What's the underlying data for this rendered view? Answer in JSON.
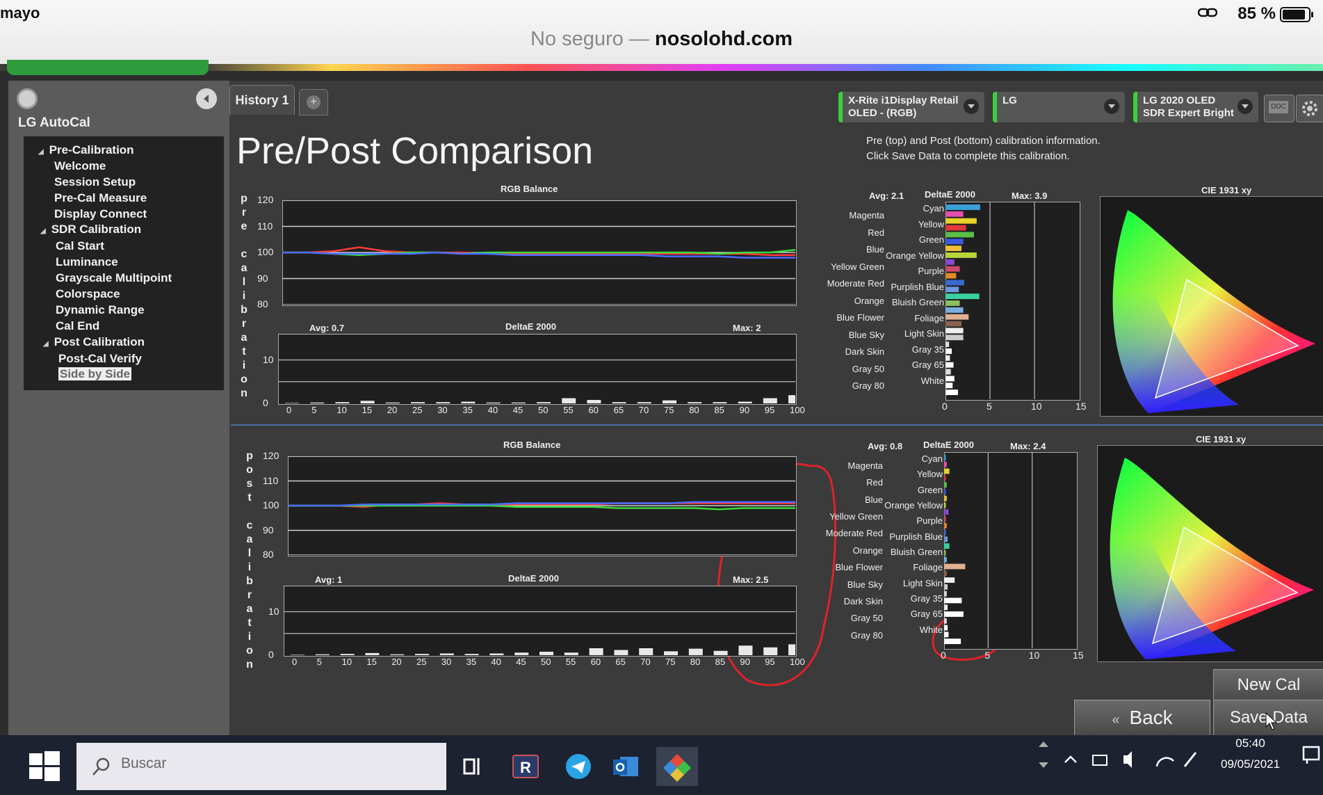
{
  "ios": {
    "time": "mayo",
    "battery": "85 %"
  },
  "browser": {
    "security": "No seguro —",
    "host": "nosolohd.com"
  },
  "sidebar": {
    "title": "LG AutoCal",
    "items": [
      {
        "label": "Pre-Calibration",
        "group": true
      },
      {
        "label": "Welcome"
      },
      {
        "label": "Session Setup"
      },
      {
        "label": "Pre-Cal Measure"
      },
      {
        "label": "Display  Connect"
      },
      {
        "label": "SDR Calibration",
        "group": true
      },
      {
        "label": "Cal Start"
      },
      {
        "label": "Luminance"
      },
      {
        "label": "Grayscale Multipoint"
      },
      {
        "label": "Colorspace"
      },
      {
        "label": "Dynamic Range"
      },
      {
        "label": "Cal End"
      },
      {
        "label": "Post Calibration",
        "group": true
      },
      {
        "label": "Post-Cal Verify"
      },
      {
        "label": "Side by Side",
        "selected": true
      }
    ]
  },
  "tabs": {
    "history": "History 1",
    "add": "+"
  },
  "toolbar": {
    "meter_line1": "X-Rite i1Display Retail",
    "meter_line2": "OLED - (RGB)",
    "display": "LG",
    "mode_line1": "LG 2020 OLED",
    "mode_line2": "SDR Expert Bright",
    "ddc": "DDC"
  },
  "page": {
    "title": "Pre/Post Comparison",
    "info_line1": "Pre (top) and Post (bottom) calibration information.",
    "info_line2": "Click Save Data to complete this calibration."
  },
  "labels": {
    "pre_side": [
      "p",
      "r",
      "e",
      "",
      "c",
      "a",
      "l",
      "i",
      "b",
      "r",
      "a",
      "t",
      "i",
      "o",
      "n"
    ],
    "post_side": [
      "p",
      "o",
      "s",
      "t",
      "",
      "c",
      "a",
      "l",
      "i",
      "b",
      "r",
      "a",
      "t",
      "i",
      "o",
      "n"
    ]
  },
  "chart_data": [
    {
      "id": "pre-rgb",
      "type": "line",
      "title": "RGB Balance",
      "yticks": [
        "120",
        "110",
        "100",
        "90",
        "80"
      ],
      "ylim": [
        80,
        120
      ],
      "x": [
        0,
        5,
        10,
        15,
        20,
        25,
        30,
        35,
        40,
        45,
        50,
        55,
        60,
        65,
        70,
        75,
        80,
        85,
        90,
        95,
        100
      ],
      "series": [
        {
          "color": "#ff3b3b",
          "values": [
            100,
            100,
            100.5,
            102,
            100.5,
            100,
            100,
            100,
            99.5,
            99.5,
            99.5,
            99.5,
            99.5,
            99.5,
            99.5,
            99.5,
            99.5,
            99.5,
            99.5,
            99,
            99
          ]
        },
        {
          "color": "#3bdc3b",
          "values": [
            100,
            100,
            99.5,
            99,
            99.5,
            100,
            100,
            99.5,
            100,
            100,
            100,
            100,
            100,
            100,
            100,
            100,
            100,
            99.5,
            100,
            100,
            101
          ]
        },
        {
          "color": "#4a6bff",
          "values": [
            100,
            100,
            99.5,
            99.5,
            99.5,
            99.5,
            100,
            99.5,
            99.5,
            99,
            99,
            99,
            99,
            99,
            99,
            98.5,
            98.5,
            98.5,
            98,
            98,
            98
          ]
        }
      ]
    },
    {
      "id": "pre-de",
      "type": "bar",
      "title": "DeltaE 2000",
      "avg": "Avg: 0.7",
      "max": "Max: 2",
      "yticks": [
        "10",
        "0"
      ],
      "ylim": [
        0,
        16
      ],
      "categories": [
        "0",
        "5",
        "10",
        "15",
        "20",
        "25",
        "30",
        "35",
        "40",
        "45",
        "50",
        "55",
        "60",
        "65",
        "70",
        "75",
        "80",
        "85",
        "90",
        "95",
        "100"
      ],
      "values": [
        0.1,
        0.2,
        0.3,
        0.6,
        0.2,
        0.3,
        0.3,
        0.4,
        0.2,
        0.2,
        0.3,
        1.2,
        0.8,
        0.3,
        0.3,
        0.7,
        0.3,
        0.3,
        0.4,
        1.2,
        1.9
      ]
    },
    {
      "id": "pre-colors",
      "type": "bar",
      "title": "DeltaE 2000",
      "avg": "Avg: 2.1",
      "max": "Max: 3.9",
      "xticks": [
        "0",
        "5",
        "10",
        "15"
      ],
      "xlim": [
        0,
        15
      ],
      "left_labels": [
        "Magenta",
        "Red",
        "Blue",
        "Yellow Green",
        "Moderate Red",
        "Orange",
        "Blue Flower",
        "Blue Sky",
        "Dark Skin",
        "Gray 50",
        "Gray 80"
      ],
      "categories": [
        "Cyan",
        "Yellow",
        "Green",
        "Orange Yellow",
        "Purple",
        "Purplish Blue",
        "Bluish Green",
        "Foliage",
        "Light Skin",
        "Gray 35",
        "Gray 65",
        "White"
      ],
      "values": [
        3.9,
        2.0,
        3.5,
        2.3,
        3.2,
        2.0,
        1.8,
        3.5,
        1.0,
        1.6,
        1.2,
        2.1,
        1.5,
        3.8,
        1.6,
        2.0,
        2.6,
        1.8,
        2.0,
        2.0,
        0.4,
        0.7,
        0.5,
        0.9,
        0.6,
        1.0,
        0.8,
        1.4
      ],
      "bar_colors": [
        "#3aa0d8",
        "#e64fb0",
        "#e8d12a",
        "#e03a3a",
        "#5bbf4a",
        "#3a5be0",
        "#ecc03a",
        "#b8d63a",
        "#8a4ad0",
        "#d04a6a",
        "#e08a2a",
        "#3a6ad0",
        "#6a9ae0",
        "#3ad0a0",
        "#8ac060",
        "#7ab0e0",
        "#e0b090",
        "#8a6050",
        "#eeeeee",
        "#cccccc",
        "#dddddd",
        "#ffffff",
        "#eeeeee",
        "#ffffff",
        "#dddddd",
        "#ffffff",
        "#ffffff",
        "#ffffff"
      ]
    },
    {
      "id": "post-rgb",
      "type": "line",
      "title": "RGB Balance",
      "yticks": [
        "120",
        "110",
        "100",
        "90",
        "80"
      ],
      "ylim": [
        80,
        120
      ],
      "x": [
        0,
        5,
        10,
        15,
        20,
        25,
        30,
        35,
        40,
        45,
        50,
        55,
        60,
        65,
        70,
        75,
        80,
        85,
        90,
        95,
        100
      ],
      "series": [
        {
          "color": "#ff3b3b",
          "values": [
            100,
            100,
            100,
            99.5,
            100.5,
            100.5,
            101,
            100.5,
            100.5,
            100.5,
            100.5,
            100.5,
            100.5,
            101,
            101,
            101,
            101,
            101,
            101,
            101,
            101
          ]
        },
        {
          "color": "#3bdc3b",
          "values": [
            100,
            100,
            100,
            100,
            100,
            100,
            100,
            100,
            100,
            99.5,
            99.5,
            99.5,
            99.5,
            99,
            99,
            99,
            99,
            98.5,
            99,
            99,
            99
          ]
        },
        {
          "color": "#4a6bff",
          "values": [
            100,
            100,
            100,
            100.5,
            100.5,
            100.5,
            100.5,
            100.5,
            100.5,
            101,
            101,
            101,
            101,
            101,
            101,
            101,
            101.5,
            101.5,
            101.5,
            101.5,
            101.5
          ]
        }
      ]
    },
    {
      "id": "post-de",
      "type": "bar",
      "title": "DeltaE 2000",
      "avg": "Avg: 1",
      "max": "Max: 2.5",
      "yticks": [
        "10",
        "0"
      ],
      "ylim": [
        0,
        16
      ],
      "categories": [
        "0",
        "5",
        "10",
        "15",
        "20",
        "25",
        "30",
        "35",
        "40",
        "45",
        "50",
        "55",
        "60",
        "65",
        "70",
        "75",
        "80",
        "85",
        "90",
        "95",
        "100"
      ],
      "values": [
        0.1,
        0.2,
        0.3,
        0.5,
        0.2,
        0.3,
        0.4,
        0.3,
        0.4,
        0.6,
        0.8,
        0.6,
        1.6,
        1.2,
        1.6,
        0.9,
        1.5,
        1.0,
        2.2,
        1.8,
        2.5
      ]
    },
    {
      "id": "post-colors",
      "type": "bar",
      "title": "DeltaE 2000",
      "avg": "Avg: 0.8",
      "max": "Max: 2.4",
      "xticks": [
        "0",
        "5",
        "10",
        "15"
      ],
      "xlim": [
        0,
        15
      ],
      "left_labels": [
        "Magenta",
        "Red",
        "Blue",
        "Yellow Green",
        "Moderate Red",
        "Orange",
        "Blue Flower",
        "Blue Sky",
        "Dark Skin",
        "Gray 50",
        "Gray 80"
      ],
      "categories": [
        "Cyan",
        "Yellow",
        "Green",
        "Orange Yellow",
        "Purple",
        "Purplish Blue",
        "Bluish Green",
        "Foliage",
        "Light Skin",
        "Gray 35",
        "Gray 65",
        "White"
      ],
      "values": [
        0.2,
        0.3,
        0.6,
        0.2,
        0.3,
        0.2,
        0.3,
        0.2,
        0.5,
        0.2,
        0.3,
        0.2,
        0.4,
        0.6,
        0.2,
        0.3,
        2.4,
        0.3,
        1.2,
        0.4,
        0.3,
        2.0,
        0.4,
        2.2,
        0.3,
        0.4,
        0.5,
        1.9
      ],
      "bar_colors": [
        "#3aa0d8",
        "#e64fb0",
        "#e8d12a",
        "#e03a3a",
        "#5bbf4a",
        "#3a5be0",
        "#ecc03a",
        "#b8d63a",
        "#8a4ad0",
        "#d04a6a",
        "#e08a2a",
        "#3a6ad0",
        "#6a9ae0",
        "#3ad0a0",
        "#8ac060",
        "#7ab0e0",
        "#e0b090",
        "#8a6050",
        "#eeeeee",
        "#cccccc",
        "#dddddd",
        "#ffffff",
        "#eeeeee",
        "#ffffff",
        "#dddddd",
        "#ffffff",
        "#ffffff",
        "#ffffff"
      ]
    }
  ],
  "cie": {
    "title": "CIE 1931 xy"
  },
  "buttons": {
    "new_cal": "New Cal",
    "back": "Back",
    "save": "Save Data"
  },
  "taskbar": {
    "search_placeholder": "Buscar",
    "time": "05:40",
    "date": "09/05/2021"
  }
}
